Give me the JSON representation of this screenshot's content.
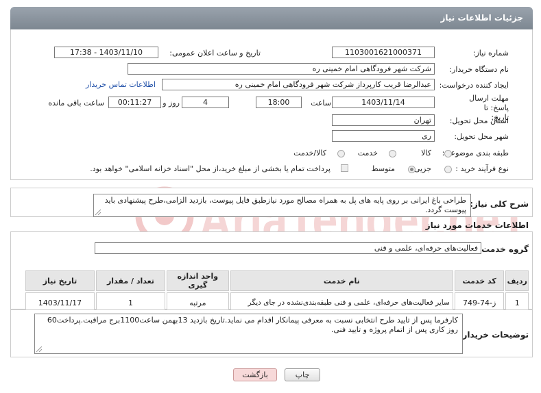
{
  "header": {
    "title": "جزئیات اطلاعات نیاز"
  },
  "form": {
    "need_number_label": "شماره نیاز:",
    "need_number": "1103001621000371",
    "announce_label": "تاریخ و ساعت اعلان عمومی:",
    "announce_value": "1403/11/10 - 17:38",
    "buyer_org_label": "نام دستگاه خریدار:",
    "buyer_org": "شرکت شهر فرودگاهی امام خمینی  ره",
    "creator_label": "ایجاد کننده درخواست:",
    "creator": "عبدالرضا قریب کارپرداز شرکت شهر فرودگاهی امام خمینی  ره",
    "contact_link": "اطلاعات تماس خریدار",
    "deadline_label": "مهلت ارسال پاسخ: تا تاریخ:",
    "deadline_date": "1403/11/14",
    "time_label": "ساعت",
    "deadline_time": "18:00",
    "days": "4",
    "days_label": "روز و",
    "remaining": "00:11:27",
    "remaining_label": "ساعت باقی مانده",
    "province_label": "استان محل تحویل:",
    "province": "تهران",
    "city_label": "شهر محل تحویل:",
    "city": "ری",
    "category_label": "طبقه بندی موضوعی:",
    "category_options": [
      "کالا",
      "خدمت",
      "کالا/خدمت"
    ],
    "process_label": "نوع فرآیند خرید :",
    "process_options": [
      "جزیی",
      "متوسط"
    ],
    "payment_note": "پرداخت تمام یا بخشی از مبلغ خرید،از محل \"اسناد خزانه اسلامی\" خواهد بود."
  },
  "summary": {
    "label": "شرح کلی نیاز:",
    "text": "طراحی باغ ایرانی بر روی پایه های پل به همراه مصالح مورد نیازطبق فایل پیوست، بازدید الزامی،طرح پیشنهادی باید پیوست گردد."
  },
  "services": {
    "section_title": "اطلاعات خدمات مورد نیاز",
    "group_label": "گروه خدمت:",
    "group_value": "فعالیت‌های حرفه‌ای، علمی و فنی",
    "columns": [
      "ردیف",
      "کد خدمت",
      "نام خدمت",
      "واحد اندازه گیری",
      "تعداد / مقدار",
      "تاریخ نیاز"
    ],
    "rows": [
      [
        "1",
        "ز-74-749",
        "سایر فعالیت‌های حرفه‌ای، علمی و فنی طبقه‌بندی‌نشده در جای دیگر",
        "مرتبه",
        "1",
        "1403/11/17"
      ]
    ]
  },
  "buyer_notes": {
    "label": "توضیحات خریدار:",
    "text": "کارفرما پس از تایید طرح انتخابی نسبت به معرفی پیمانکار اقدام می نماید.تاریخ بازدید 13بهمن ساعت1100برج مراقبت.پرداخت60 روز کاری پس از اتمام پروژه و تایید فنی."
  },
  "buttons": {
    "print": "چاپ",
    "back": "بازگشت"
  },
  "watermark": {
    "text": "AriaTender.neT"
  },
  "colors": {
    "header": "#8a939c",
    "link": "#1f4fa8",
    "back_button": "#f7d9d9",
    "watermark": "#f2c9c9"
  }
}
